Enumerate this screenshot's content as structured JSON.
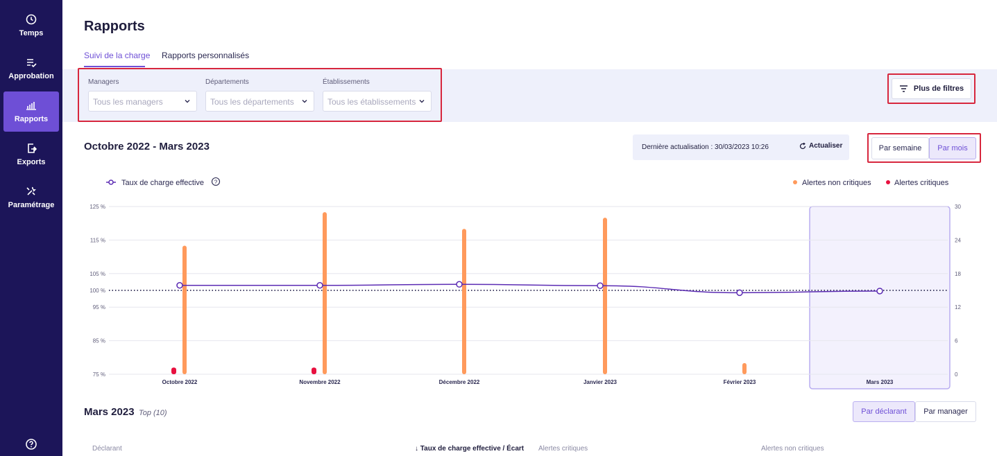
{
  "sidebar": {
    "items": [
      {
        "label": "Temps",
        "icon": "clock-icon"
      },
      {
        "label": "Approbation",
        "icon": "checklist-icon"
      },
      {
        "label": "Rapports",
        "icon": "bar-chart-icon",
        "active": true
      },
      {
        "label": "Exports",
        "icon": "export-icon"
      },
      {
        "label": "Paramétrage",
        "icon": "tools-icon"
      }
    ],
    "help_icon": "help-icon"
  },
  "header": {
    "title": "Rapports",
    "tabs": [
      {
        "label": "Suivi de la charge",
        "active": true
      },
      {
        "label": "Rapports personnalisés",
        "active": false
      }
    ]
  },
  "filters": {
    "managers": {
      "label": "Managers",
      "value": "Tous les managers"
    },
    "departements": {
      "label": "Départements",
      "value": "Tous les départements"
    },
    "etablissements": {
      "label": "Établissements",
      "value": "Tous les établissements"
    },
    "more_button": "Plus de filtres"
  },
  "period": {
    "title": "Octobre 2022 - Mars 2023",
    "last_update": "Dernière actualisation : 30/03/2023 10:26",
    "refresh_label": "Actualiser",
    "view_week": "Par semaine",
    "view_month": "Par mois",
    "view_selected": "month"
  },
  "chart_data": {
    "type": "bar+line",
    "categories": [
      "Octobre 2022",
      "Novembre 2022",
      "Décembre 2022",
      "Janvier 2023",
      "Février 2023",
      "Mars 2023"
    ],
    "selected_category": "Mars 2023",
    "legend": {
      "line": "Taux de charge effective",
      "orange": "Alertes non critiques",
      "red": "Alertes critiques",
      "placement": "top"
    },
    "left_axis": {
      "min": 75,
      "max": 125,
      "ticks": [
        "125 %",
        "115 %",
        "105 %",
        "100 %",
        "95 %",
        "85 %",
        "75 %"
      ],
      "tick_values": [
        125,
        115,
        105,
        100,
        95,
        85,
        75
      ]
    },
    "right_axis": {
      "min": 0,
      "max": 30,
      "ticks": [
        "30",
        "24",
        "18",
        "12",
        "6",
        "0"
      ],
      "tick_values": [
        30,
        24,
        18,
        12,
        6,
        0
      ]
    },
    "reference_line": 100,
    "series": [
      {
        "name": "Taux de charge effective",
        "kind": "line",
        "color": "#5b2bb3",
        "values": [
          101.5,
          101.5,
          101.8,
          101.4,
          99.3,
          99.8
        ]
      },
      {
        "name": "Alertes non critiques",
        "kind": "bar",
        "color": "#ff9a5c",
        "values": [
          23,
          29,
          26,
          28,
          2,
          0
        ]
      },
      {
        "name": "Alertes critiques",
        "kind": "bar",
        "color": "#e8103f",
        "values": [
          1,
          1,
          0,
          0,
          0,
          0
        ]
      }
    ]
  },
  "colors": {
    "accent": "#6e4fd6",
    "sidebar": "#1c1559",
    "highlight_red": "#d7263d"
  },
  "detail": {
    "title": "Mars 2023",
    "badge": "Top (10)",
    "toggle_declarant": "Par déclarant",
    "toggle_manager": "Par manager",
    "toggle_selected": "declarant",
    "columns": {
      "declarant": "Déclarant",
      "taux": "Taux de charge effective / Écart",
      "critiques": "Alertes critiques",
      "non_critiques": "Alertes non critiques"
    }
  }
}
